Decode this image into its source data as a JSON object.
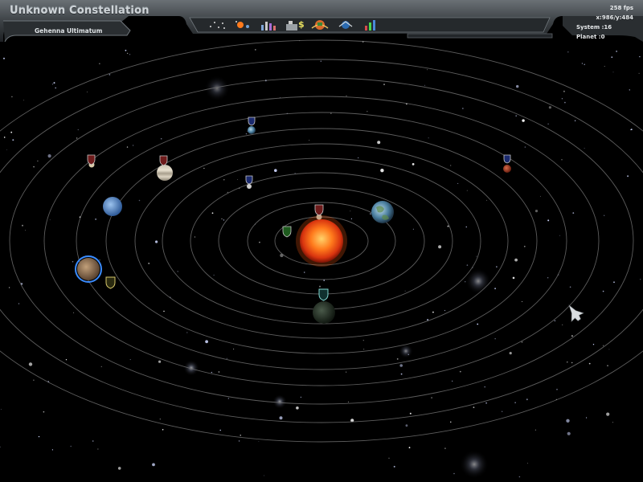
{
  "window": {
    "title": "Unknown Constellation",
    "subtitle": "Gehenna Ultimatum"
  },
  "status": {
    "fps": "258 fps",
    "coords": "x:986/y:484",
    "system": "System :16",
    "planet": "Planet :0"
  },
  "toolbar": {
    "buttons": [
      {
        "icon": "star-map-icon"
      },
      {
        "icon": "solar-system-icon"
      },
      {
        "icon": "statistics-icon"
      },
      {
        "icon": "economy-icon"
      },
      {
        "icon": "planet-colonize-icon"
      },
      {
        "icon": "fleet-icon"
      },
      {
        "icon": "research-chart-icon"
      }
    ]
  },
  "colors": {
    "sun": "#e5571a",
    "orbit": "#6d6d6d",
    "frame": "#4a4f53"
  }
}
